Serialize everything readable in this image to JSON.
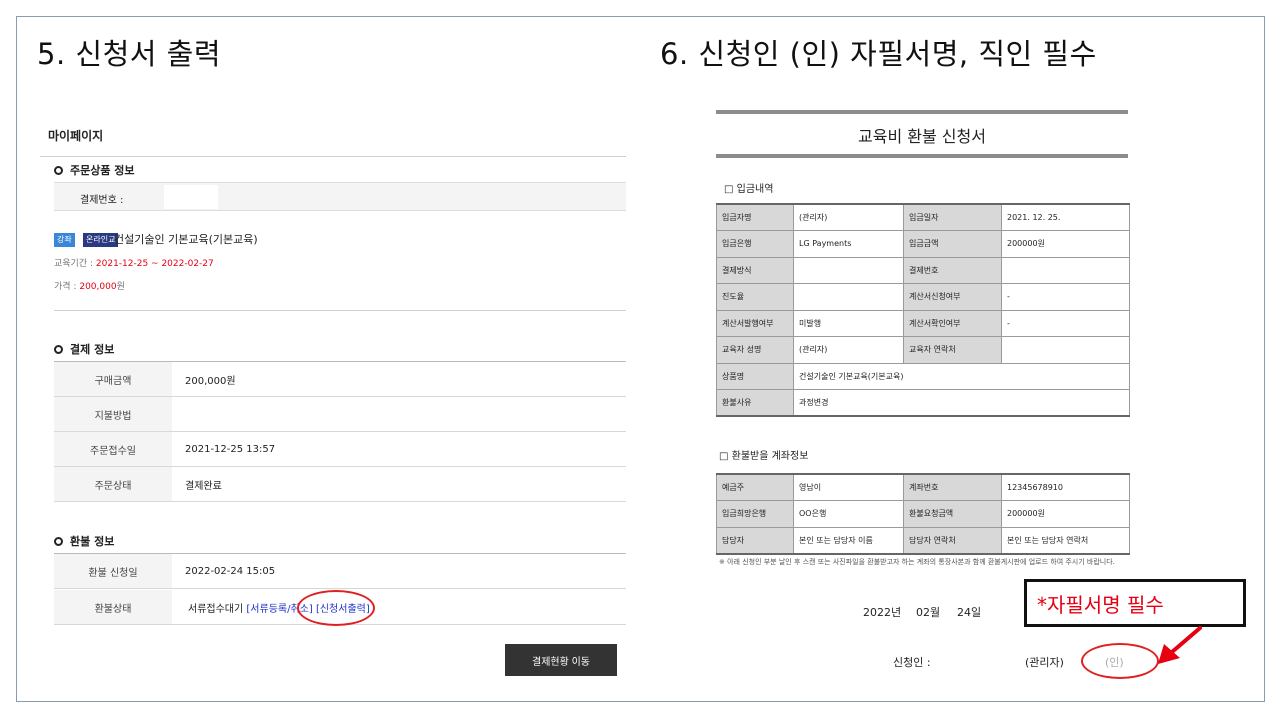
{
  "slides": {
    "step5_title": "5. 신청서 출력",
    "step6_title": "6. 신청인 (인) 자필서명, 직인 필수"
  },
  "mypage": {
    "heading": "마이페이지",
    "order": {
      "section_title": "주문상품 정보",
      "payment_no_label": "결제번호 :",
      "badge_course": "강좌",
      "badge_online": "온라인교",
      "product_name": "건설기술인 기본교육(기본교육)",
      "period_label": "교육기간 :",
      "period_value": "2021-12-25 ~ 2022-02-27",
      "price_label": "가격 :",
      "price_value": "200,000",
      "price_unit": "원"
    },
    "payment": {
      "section_title": "결제 정보",
      "rows": [
        {
          "label": "구매금액",
          "value": "200,000원"
        },
        {
          "label": "지불방법",
          "value": ""
        },
        {
          "label": "주문접수일",
          "value": "2021-12-25 13:57"
        },
        {
          "label": "주문상태",
          "value": "결제완료"
        }
      ]
    },
    "refund": {
      "section_title": "환불 정보",
      "apply_label": "환불 신청일",
      "apply_value": "2022-02-24 15:05",
      "status_label": "환불상태",
      "status_value": "서류접수대기",
      "link_docs": "[서류등록/취소]",
      "link_print": "[신청서출력]"
    },
    "move_button": "결제현황 이동"
  },
  "form": {
    "title": "교육비 환불 신청서",
    "section1": "□ 입금내역",
    "table1": [
      [
        "입금자명",
        "(관리자)",
        "입금일자",
        "2021. 12. 25."
      ],
      [
        "입금은행",
        "LG Payments",
        "입금금액",
        "200000원"
      ],
      [
        "결제방식",
        "",
        "결제번호",
        ""
      ],
      [
        "진도율",
        "",
        "계산서신청여부",
        "-"
      ],
      [
        "계산서발행여부",
        "미발행",
        "계산서확인여부",
        "-"
      ],
      [
        "교육자 성명",
        "(관리자)",
        "교육자 연락처",
        ""
      ]
    ],
    "product_label": "상품명",
    "product_value": "건설기술인 기본교육(기본교육)",
    "reason_label": "환불사유",
    "reason_value": "과정변경",
    "section2": "□ 환불받을 계좌정보",
    "table2": [
      [
        "예금주",
        "영남이",
        "계좌번호",
        "12345678910"
      ],
      [
        "입금희망은행",
        "OO은행",
        "환불요청금액",
        "200000원"
      ],
      [
        "담당자",
        "본인 또는 담당자 이름",
        "담당자 연락처",
        "본인 또는 담당자 연락처"
      ]
    ],
    "note": "※ 아래 신청인 부분 날인 후 스캔 또는 사진파일을 환불받고자 하는 계좌의 통장사본과 함께 환불게시판에 업로드 하여 주시기 바랍니다.",
    "date_year": "2022년",
    "date_month": "02월",
    "date_day": "24일",
    "applicant_label": "신청인 :",
    "applicant_name": "(관리자)",
    "seal": "(인)"
  },
  "callout": {
    "text": "*자필서명 필수",
    "color": "#e60012"
  },
  "colors": {
    "highlight": "#e02020",
    "link": "#2233cc",
    "button": "#333333"
  }
}
